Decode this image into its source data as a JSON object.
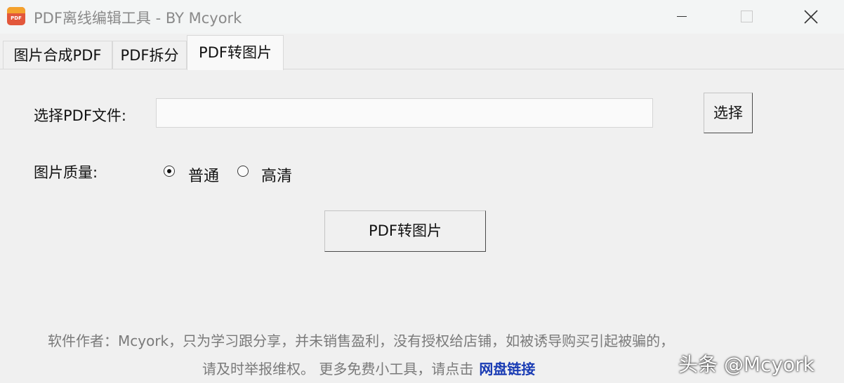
{
  "window": {
    "icon_text": "PDF",
    "title": "PDF离线编辑工具 - BY Mcyork"
  },
  "tabs": [
    {
      "label": "图片合成PDF",
      "selected": false
    },
    {
      "label": "PDF拆分",
      "selected": false
    },
    {
      "label": "PDF转图片",
      "selected": true
    }
  ],
  "form": {
    "file_label": "选择PDF文件:",
    "file_value": "",
    "file_placeholder": "",
    "select_button": "选择",
    "quality_label": "图片质量:",
    "quality_options": [
      {
        "label": "普通",
        "checked": true
      },
      {
        "label": "高清",
        "checked": false
      }
    ],
    "convert_button": "PDF转图片"
  },
  "footer": {
    "line1": "软件作者：Mcyork，只为学习跟分享，并未销售盈利，没有授权给店铺，如被诱导购买引起被骗的，",
    "line2": "请及时举报维权。 更多免费小工具，请点击",
    "link_text": "网盘链接"
  },
  "watermark": "头条 @Mcyork",
  "colors": {
    "background": "#f0f0f0",
    "link": "#1a3cb4",
    "footer_text": "#7a7a7a"
  }
}
